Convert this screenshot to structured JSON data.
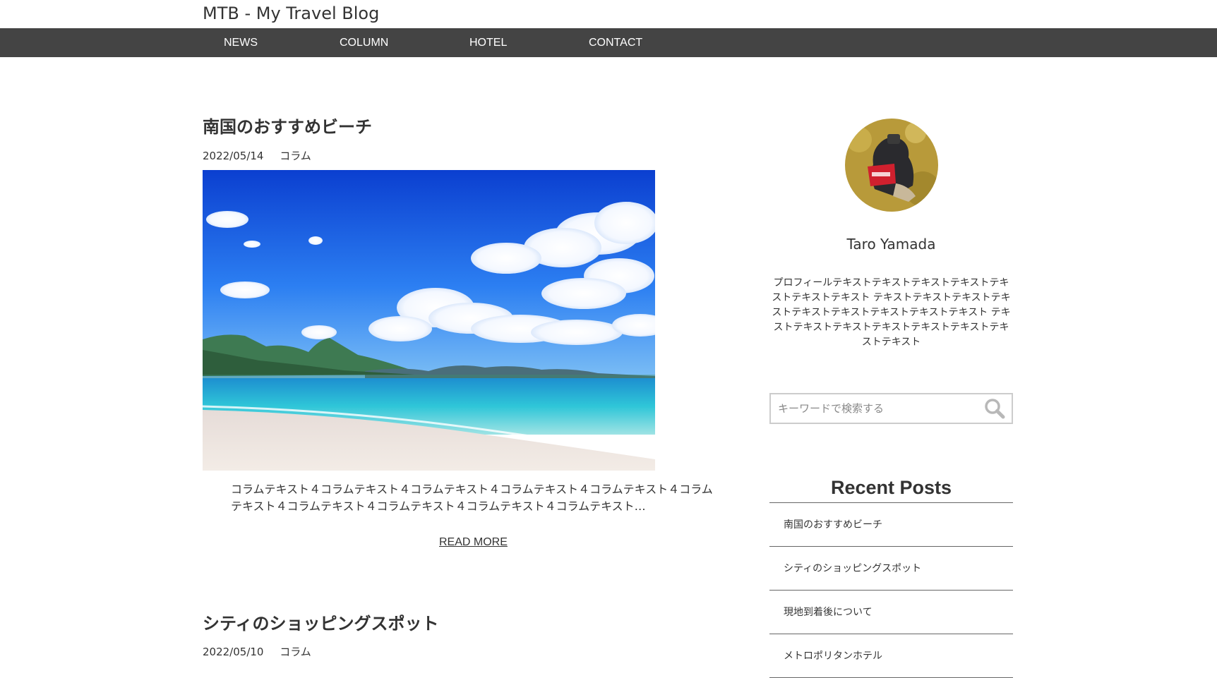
{
  "site": {
    "title": "MTB - My Travel Blog"
  },
  "nav": {
    "items": [
      {
        "label": "NEWS"
      },
      {
        "label": "COLUMN"
      },
      {
        "label": "HOTEL"
      },
      {
        "label": "CONTACT"
      }
    ]
  },
  "posts": [
    {
      "title": "南国のおすすめビーチ",
      "date": "2022/05/14",
      "category": "コラム",
      "excerpt": "コラムテキスト４コラムテキスト４コラムテキスト４コラムテキスト４コラムテキスト４コラムテキスト４コラムテキスト４コラムテキスト４コラムテキスト４コラムテキスト…",
      "read_more": "READ MORE"
    },
    {
      "title": "シティのショッピングスポット",
      "date": "2022/05/10",
      "category": "コラム"
    }
  ],
  "sidebar": {
    "profile": {
      "name": "Taro Yamada",
      "text": "プロフィールテキストテキストテキストテキストテキストテキストテキスト テキストテキストテキストテキストテキストテキストテキストテキストテキスト テキストテキストテキストテキストテキストテキストテキストテキスト"
    },
    "search": {
      "placeholder": "キーワードで検索する"
    },
    "recent": {
      "title": "Recent Posts",
      "items": [
        {
          "label": "南国のおすすめビーチ"
        },
        {
          "label": "シティのショッピングスポット"
        },
        {
          "label": "現地到着後について"
        },
        {
          "label": "メトロポリタンホテル"
        }
      ]
    }
  },
  "colors": {
    "nav_background": "#444444",
    "nav_text": "#ffffff",
    "text": "#333333",
    "divider": "#666666"
  }
}
